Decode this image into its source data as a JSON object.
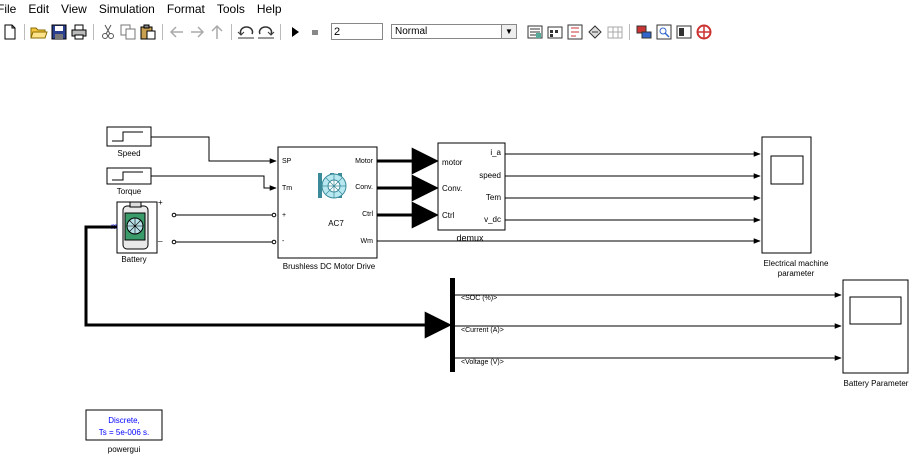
{
  "menu": [
    "File",
    "Edit",
    "View",
    "Simulation",
    "Format",
    "Tools",
    "Help"
  ],
  "toolbar": {
    "stop_time": "2",
    "sim_mode": "Normal",
    "icons_left": [
      "new-icon",
      "open-icon",
      "save-icon",
      "print-icon",
      "cut-icon",
      "copy-icon",
      "paste-icon",
      "back-icon",
      "forward-icon",
      "up-icon",
      "undo-icon",
      "redo-icon",
      "play-icon",
      "stop-icon"
    ],
    "icons_right": [
      "build-icon",
      "library-icon",
      "model-explorer-icon",
      "debugger-icon",
      "grid-icon",
      "build-model-icon",
      "model-advisor-icon",
      "display-icon",
      "help-icon"
    ]
  },
  "blocks": {
    "speed": {
      "label": "Speed"
    },
    "torque": {
      "label": "Torque"
    },
    "battery": {
      "label": "Battery",
      "plus": "+",
      "minus": "_",
      "port": "m"
    },
    "motor_drive": {
      "label": "Brushless DC Motor Drive",
      "inner": "AC7",
      "in_ports": [
        "SP",
        "Tm",
        "+",
        "-"
      ],
      "out_ports": [
        "Motor",
        "Conv.",
        "Ctrl",
        "Wm"
      ]
    },
    "demux": {
      "label": "demux",
      "in_ports": [
        "motor",
        "Conv.",
        "Ctrl"
      ],
      "out_ports": [
        "i_a",
        "speed",
        "Tem",
        "v_dc"
      ]
    },
    "scope1": {
      "label_line1": "Electrical machine",
      "label_line2": "parameter"
    },
    "bus": {
      "signals": [
        "<SOC (%)>",
        "<Current (A)>",
        "<Voltage (V)>"
      ]
    },
    "scope2": {
      "label": "Battery Parameter"
    },
    "powergui": {
      "line1": "Discrete,",
      "line2": "Ts = 5e-006 s.",
      "label": "powergui"
    }
  },
  "colors": {
    "accent_blue": "#0000ff",
    "line": "#000000"
  }
}
